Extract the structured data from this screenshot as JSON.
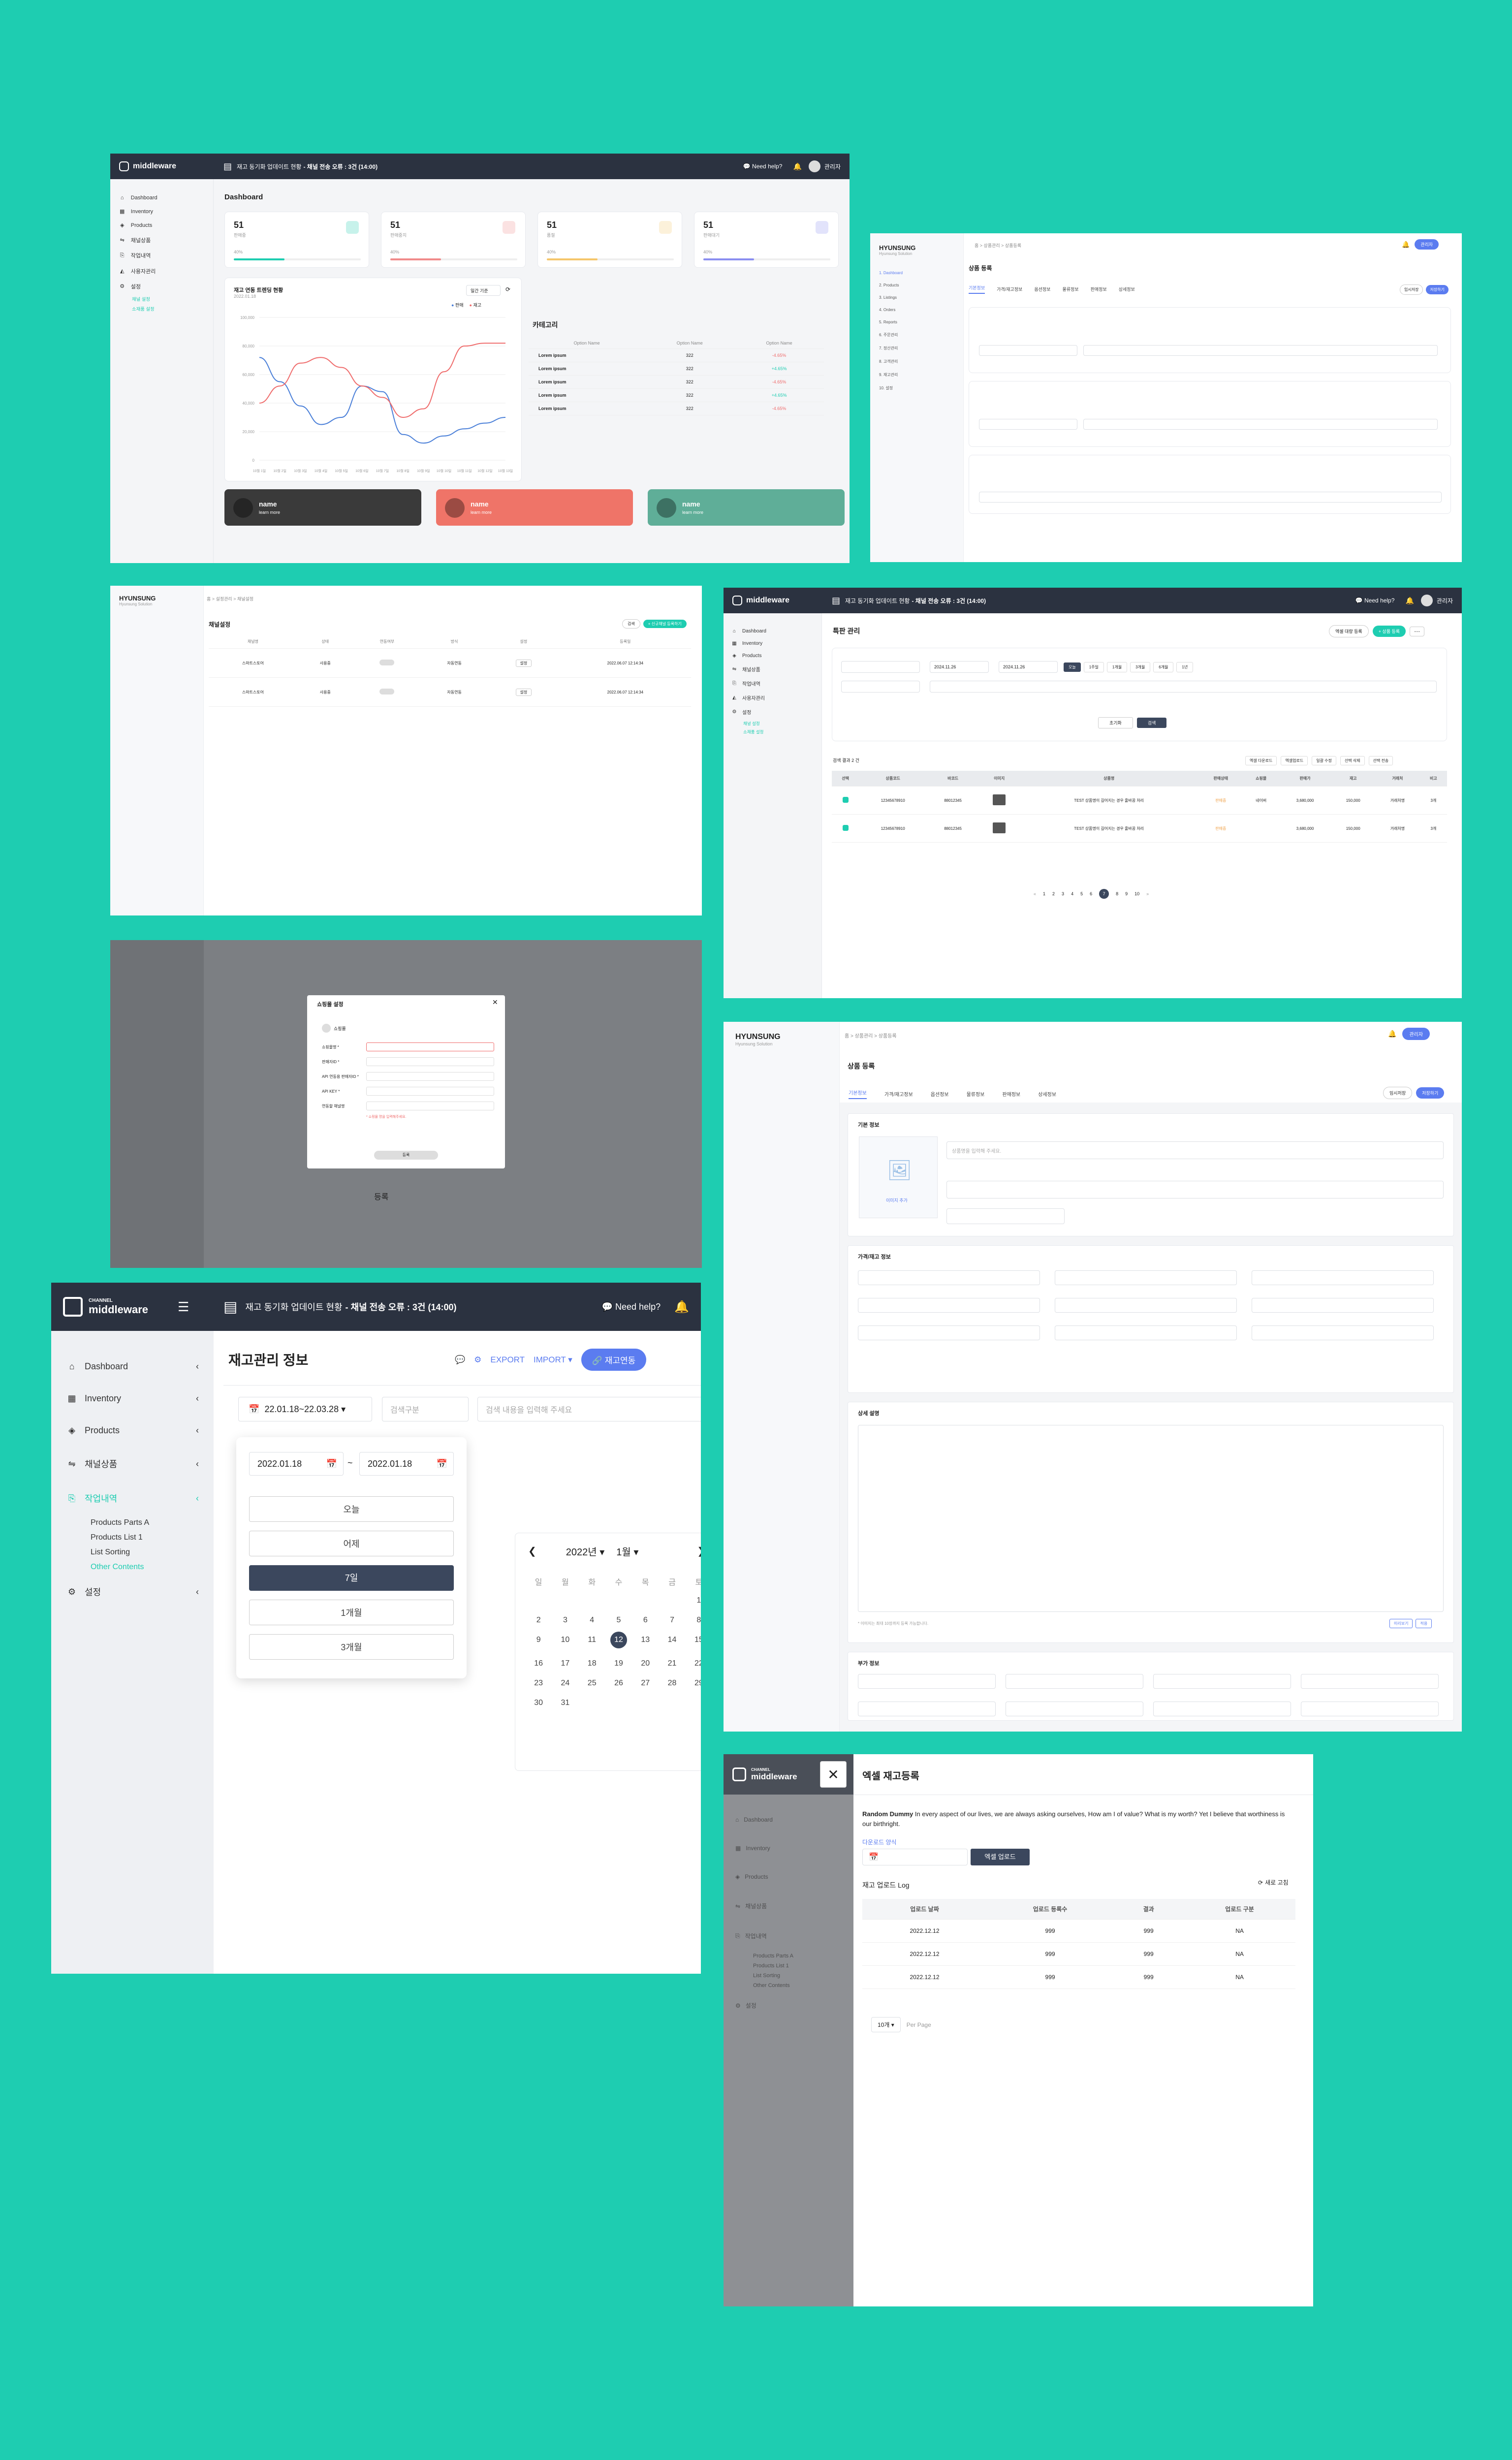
{
  "brand": {
    "small": "CHANNEL",
    "name": "middleware",
    "alt": "HYUNSUNG",
    "alt_sub": "Hyunsung Solution"
  },
  "topbar": {
    "notice": "재고 동기화 업데이트 현황",
    "error": "- 채널 전송 오류 : 3건 (14:00)",
    "help": "Need help?",
    "user": "관리자"
  },
  "nav": [
    {
      "label": "Dashboard",
      "icon": "home-icon"
    },
    {
      "label": "Inventory",
      "icon": "box-icon"
    },
    {
      "label": "Products",
      "icon": "tag-icon"
    },
    {
      "label": "채널상품",
      "icon": "signpost-icon"
    },
    {
      "label": "작업내역",
      "icon": "history-icon"
    },
    {
      "label": "사용자관리",
      "icon": "user-icon"
    },
    {
      "label": "설정",
      "icon": "gear-icon"
    }
  ],
  "nav_sub": [
    "채널 설정",
    "소재품 설정"
  ],
  "nav_sub2": [
    "Products Parts A",
    "Products List 1",
    "List Sorting",
    "Other Contents"
  ],
  "alt_nav": [
    "1. Dashboard",
    "2. Products",
    "3. Listings",
    "4. Orders",
    "5. Reports",
    "6. 주문관리",
    "7. 정산관리",
    "8. 고객관리",
    "9. 재고관리",
    "10. 설정"
  ],
  "dashboard": {
    "title": "Dashboard",
    "stats": [
      {
        "value": "51",
        "label": "판매중",
        "pct": "40%",
        "color": "#1ecdb1"
      },
      {
        "value": "51",
        "label": "판매중지",
        "pct": "40%",
        "color": "#f08a8a"
      },
      {
        "value": "51",
        "label": "품절",
        "pct": "40%",
        "color": "#f5c66b"
      },
      {
        "value": "51",
        "label": "판매대기",
        "pct": "40%",
        "color": "#8a8ef0"
      }
    ],
    "chart_title": "재고 연동 트렌딩 현황",
    "chart_sub": "2022.01.18",
    "chart_filter": "일간 기준",
    "legend": [
      "판매",
      "재고"
    ],
    "category_title": "카테고리",
    "cat_headers": [
      "Option Name",
      "Option Name",
      "Option Name"
    ],
    "cat_rows": [
      [
        "Lorem ipsum",
        "322",
        "-4.65%"
      ],
      [
        "Lorem ipsum",
        "322",
        "+4.65%"
      ],
      [
        "Lorem ipsum",
        "322",
        "-4.65%"
      ],
      [
        "Lorem ipsum",
        "322",
        "+4.65%"
      ],
      [
        "Lorem ipsum",
        "322",
        "-4.65%"
      ]
    ],
    "banners": [
      {
        "name": "name",
        "sub": "learn more",
        "color": "#3a3a3a"
      },
      {
        "name": "name",
        "sub": "learn more",
        "color": "#ef7468"
      },
      {
        "name": "name",
        "sub": "learn more",
        "color": "#5fae98"
      }
    ]
  },
  "chart_data": {
    "type": "line",
    "x": [
      "10월 1일",
      "10월 2일",
      "10월 3일",
      "10월 4일",
      "10월 5일",
      "10월 6일",
      "10월 7일",
      "10월 8일",
      "10월 9일",
      "10월 10일",
      "10월 11일",
      "10월 12일",
      "10월 13일"
    ],
    "series": [
      {
        "name": "판매",
        "color": "#4a7fd8",
        "values": [
          72000,
          55000,
          38000,
          25000,
          30000,
          52000,
          48000,
          18000,
          12000,
          17000,
          22000,
          26000,
          30000
        ]
      },
      {
        "name": "재고",
        "color": "#ef6c6c",
        "values": [
          40000,
          52000,
          68000,
          72000,
          65000,
          52000,
          44000,
          30000,
          36000,
          62000,
          80000,
          82000,
          82000
        ]
      }
    ],
    "yticks": [
      "100,000",
      "80,000",
      "60,000",
      "40,000",
      "20,000",
      "0"
    ],
    "ylim": [
      0,
      100000
    ],
    "grid": true,
    "legend": "top-right"
  },
  "reg": {
    "crumb": "홈 > 상품관리 > 상품등록",
    "title": "상품 등록",
    "tabs": [
      "기본정보",
      "가격/재고정보",
      "옵션정보",
      "물류정보",
      "판매정보",
      "상세정보"
    ],
    "btn_save": "임시저장",
    "btn_submit": "저장하기",
    "sec1": "기본 정보",
    "img_add": "이미지 추가",
    "placeholder": "상품명을 입력해 주세요.",
    "sec2": "가격/재고 정보",
    "sec3": "상세 설명",
    "sec4": "부가 정보",
    "hint": "* 이미지는 최대 10장까지 등록 가능합니다.",
    "btn_preview": "미리보기",
    "btn_apply": "적용"
  },
  "channel": {
    "title": "채널설정",
    "crumb": "홈 > 설정관리 > 채널설정",
    "headers": [
      "채널명",
      "상태",
      "연동여부",
      "방식",
      "설정",
      "등록일"
    ],
    "rows": [
      [
        "스마트스토어",
        "사용중",
        "",
        "자동연동",
        "설정",
        "2022.06.07 12:14:34"
      ],
      [
        "스마트스토어",
        "사용중",
        "",
        "자동연동",
        "설정",
        "2022.06.07 12:14:34"
      ]
    ],
    "btn_new": "+ 신규채널 등록하기",
    "btn_top": "검색"
  },
  "modal": {
    "title": "쇼핑몰 설정",
    "logo": "쇼핑몰",
    "fields": [
      "쇼핑몰명 *",
      "판매자ID *",
      "API 연동용 판매자ID *",
      "API KEY *",
      "연동할 채널명"
    ],
    "error": "* 쇼핑몰 명을 입력해주세요.",
    "confirm": "등록"
  },
  "stock": {
    "title": "재고관리 정보",
    "export": "EXPORT",
    "import": "IMPORT",
    "btn": "재고연동",
    "date_range": "22.01.18~22.03.28",
    "date_from": "2022.01.18",
    "date_to": "2022.01.18",
    "search_ph": "검색 내용을 입력해 주세요",
    "select_ph": "검색구분",
    "quick": [
      "오늘",
      "어제",
      "7일",
      "1개월",
      "3개월"
    ],
    "active": "7일",
    "cal_year": "2022년",
    "cal_month": "1월",
    "weekdays": [
      "일",
      "월",
      "화",
      "수",
      "목",
      "금",
      "토"
    ],
    "today": "12"
  },
  "list": {
    "title": "특판 관리",
    "btn_excel": "엑셀 대량 등록",
    "btn_new": "+ 상품 등록",
    "date_from": "2024.11.26",
    "date_to": "2024.11.26",
    "periods": [
      "오늘",
      "1주일",
      "1개월",
      "3개월",
      "6개월",
      "1년"
    ],
    "btn_reset": "초기화",
    "btn_search": "검색",
    "total": "검색 결과 2 건",
    "tools": [
      "엑셀 다운로드",
      "엑셀업로드",
      "일괄 수정",
      "선택 삭제",
      "선택 전송"
    ],
    "headers": [
      "선택",
      "상품코드",
      "바코드",
      "이미지",
      "상품명",
      "판매상태",
      "쇼핑몰",
      "판매가",
      "재고",
      "거래처",
      "비고"
    ],
    "rows": [
      [
        "",
        "12345678910",
        "88012345",
        "",
        "TEST 상품명이 길어지는 경우 줄바꿈 처리",
        "판매중",
        "네이버",
        "3,680,000",
        "150,000",
        "거래처명",
        "3개"
      ],
      [
        "",
        "12345678910",
        "88012345",
        "",
        "TEST 상품명이 길어지는 경우 줄바꿈 처리",
        "판매중",
        "",
        "3,680,000",
        "150,000",
        "거래처명",
        "3개"
      ]
    ],
    "pages": [
      "1",
      "2",
      "3",
      "4",
      "5",
      "6",
      "7",
      "8",
      "9",
      "10"
    ],
    "current_page": "7"
  },
  "excel": {
    "title": "엑셀 재고등록",
    "desc_bold": "Random Dummy",
    "desc": "In every aspect of our lives, we are always asking ourselves, How am I of value? What is my worth? Yet I believe that worthiness is our birthright.",
    "link": "다운로드 양식",
    "btn_upload": "엑셀 업로드",
    "log_title": "재고 업로드 Log",
    "refresh": "새로 고침",
    "headers": [
      "업로드 날짜",
      "업로드 등록수",
      "결과",
      "업로드 구분"
    ],
    "rows": [
      [
        "2022.12.12",
        "999",
        "999",
        "NA"
      ],
      [
        "2022.12.12",
        "999",
        "999",
        "NA"
      ],
      [
        "2022.12.12",
        "999",
        "999",
        "NA"
      ]
    ],
    "per_page": "10개",
    "per_page_label": "Per Page"
  }
}
